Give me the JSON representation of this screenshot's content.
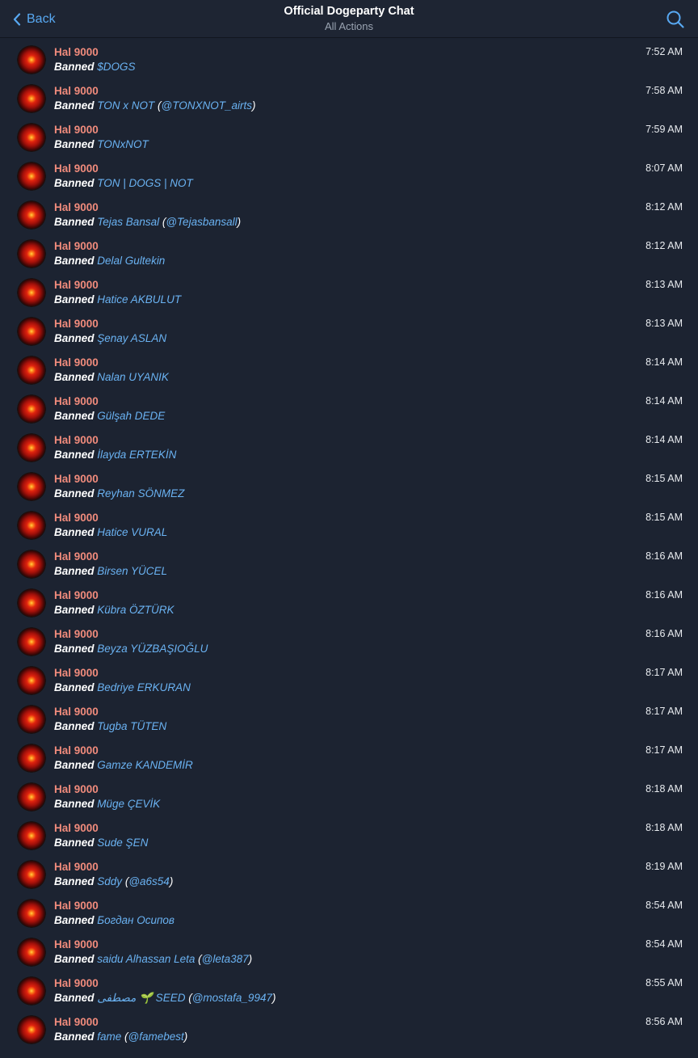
{
  "header": {
    "back_label": "Back",
    "title": "Official Dogeparty Chat",
    "subtitle": "All Actions"
  },
  "log": [
    {
      "name": "Hal 9000",
      "action": "Banned",
      "target": "$DOGS",
      "username": "",
      "time": "7:52 AM"
    },
    {
      "name": "Hal 9000",
      "action": "Banned",
      "target": "TON x NOT",
      "username": "@TONXNOT_airts",
      "time": "7:58 AM"
    },
    {
      "name": "Hal 9000",
      "action": "Banned",
      "target": "TONxNOT",
      "username": "",
      "time": "7:59 AM"
    },
    {
      "name": "Hal 9000",
      "action": "Banned",
      "target": "TON | DOGS | NOT",
      "username": "",
      "time": "8:07 AM"
    },
    {
      "name": "Hal 9000",
      "action": "Banned",
      "target": "Tejas Bansal",
      "username": "@Tejasbansall",
      "time": "8:12 AM"
    },
    {
      "name": "Hal 9000",
      "action": "Banned",
      "target": "Delal Gultekin",
      "username": "",
      "time": "8:12 AM"
    },
    {
      "name": "Hal 9000",
      "action": "Banned",
      "target": "Hatice AKBULUT",
      "username": "",
      "time": "8:13 AM"
    },
    {
      "name": "Hal 9000",
      "action": "Banned",
      "target": "Şenay ASLAN",
      "username": "",
      "time": "8:13 AM"
    },
    {
      "name": "Hal 9000",
      "action": "Banned",
      "target": "Nalan UYANIK",
      "username": "",
      "time": "8:14 AM"
    },
    {
      "name": "Hal 9000",
      "action": "Banned",
      "target": "Gülşah DEDE",
      "username": "",
      "time": "8:14 AM"
    },
    {
      "name": "Hal 9000",
      "action": "Banned",
      "target": "İlayda ERTEKİN",
      "username": "",
      "time": "8:14 AM"
    },
    {
      "name": "Hal 9000",
      "action": "Banned",
      "target": "Reyhan SÖNMEZ",
      "username": "",
      "time": "8:15 AM"
    },
    {
      "name": "Hal 9000",
      "action": "Banned",
      "target": "Hatice VURAL",
      "username": "",
      "time": "8:15 AM"
    },
    {
      "name": "Hal 9000",
      "action": "Banned",
      "target": "Birsen YÜCEL",
      "username": "",
      "time": "8:16 AM"
    },
    {
      "name": "Hal 9000",
      "action": "Banned",
      "target": "Kübra ÖZTÜRK",
      "username": "",
      "time": "8:16 AM"
    },
    {
      "name": "Hal 9000",
      "action": "Banned",
      "target": "Beyza YÜZBAŞIOĞLU",
      "username": "",
      "time": "8:16 AM"
    },
    {
      "name": "Hal 9000",
      "action": "Banned",
      "target": "Bedriye ERKURAN",
      "username": "",
      "time": "8:17 AM"
    },
    {
      "name": "Hal 9000",
      "action": "Banned",
      "target": "Tugba TÜTEN",
      "username": "",
      "time": "8:17 AM"
    },
    {
      "name": "Hal 9000",
      "action": "Banned",
      "target": "Gamze KANDEMİR",
      "username": "",
      "time": "8:17 AM"
    },
    {
      "name": "Hal 9000",
      "action": "Banned",
      "target": "Müge ÇEVİK",
      "username": "",
      "time": "8:18 AM"
    },
    {
      "name": "Hal 9000",
      "action": "Banned",
      "target": "Sude ŞEN",
      "username": "",
      "time": "8:18 AM"
    },
    {
      "name": "Hal 9000",
      "action": "Banned",
      "target": "Sddy",
      "username": "@a6s54",
      "time": "8:19 AM"
    },
    {
      "name": "Hal 9000",
      "action": "Banned",
      "target": "Богдан Осипов",
      "username": "",
      "time": "8:54 AM"
    },
    {
      "name": "Hal 9000",
      "action": "Banned",
      "target": " saidu Alhassan Leta",
      "username": "@leta387",
      "time": "8:54 AM"
    },
    {
      "name": "Hal 9000",
      "action": "Banned",
      "target": "مصطفى 🌱 SEED",
      "username": "@mostafa_9947",
      "time": "8:55 AM"
    },
    {
      "name": "Hal 9000",
      "action": "Banned",
      "target": "fame",
      "username": "@famebest",
      "time": "8:56 AM"
    }
  ],
  "colors": {
    "background": "#1c2331",
    "accent": "#58a9f3",
    "author_name": "#f08b7c",
    "link": "#6ab2f2"
  },
  "icons": {
    "back": "chevron-left-icon",
    "search": "search-icon",
    "avatar": "hal-9000-eye-avatar"
  }
}
